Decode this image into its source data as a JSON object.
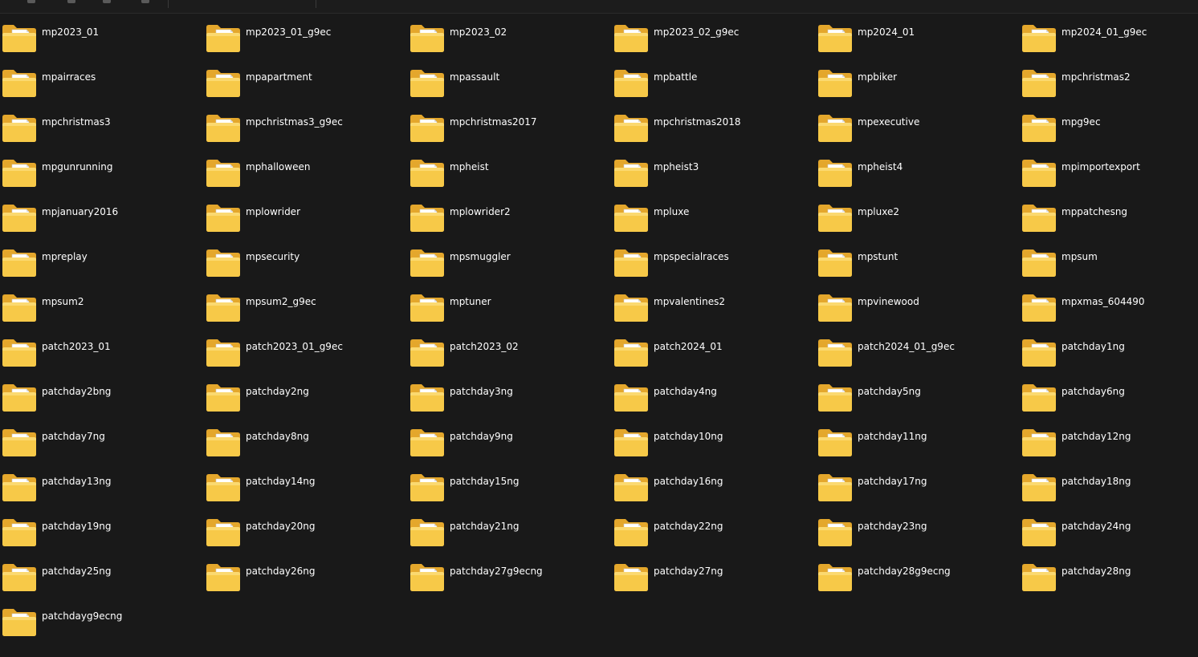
{
  "toolbar": {
    "icons": [
      "view-icon",
      "share-icon",
      "copy-icon",
      "delete-icon"
    ]
  },
  "colors": {
    "background": "#191919",
    "text": "#ffffff",
    "folder_front": "#f7c948",
    "folder_back": "#e4a72c"
  },
  "folders": [
    "mp2023_01",
    "mp2023_01_g9ec",
    "mp2023_02",
    "mp2023_02_g9ec",
    "mp2024_01",
    "mp2024_01_g9ec",
    "mpairraces",
    "mpapartment",
    "mpassault",
    "mpbattle",
    "mpbiker",
    "mpchristmas2",
    "mpchristmas3",
    "mpchristmas3_g9ec",
    "mpchristmas2017",
    "mpchristmas2018",
    "mpexecutive",
    "mpg9ec",
    "mpgunrunning",
    "mphalloween",
    "mpheist",
    "mpheist3",
    "mpheist4",
    "mpimportexport",
    "mpjanuary2016",
    "mplowrider",
    "mplowrider2",
    "mpluxe",
    "mpluxe2",
    "mppatchesng",
    "mpreplay",
    "mpsecurity",
    "mpsmuggler",
    "mpspecialraces",
    "mpstunt",
    "mpsum",
    "mpsum2",
    "mpsum2_g9ec",
    "mptuner",
    "mpvalentines2",
    "mpvinewood",
    "mpxmas_604490",
    "patch2023_01",
    "patch2023_01_g9ec",
    "patch2023_02",
    "patch2024_01",
    "patch2024_01_g9ec",
    "patchday1ng",
    "patchday2bng",
    "patchday2ng",
    "patchday3ng",
    "patchday4ng",
    "patchday5ng",
    "patchday6ng",
    "patchday7ng",
    "patchday8ng",
    "patchday9ng",
    "patchday10ng",
    "patchday11ng",
    "patchday12ng",
    "patchday13ng",
    "patchday14ng",
    "patchday15ng",
    "patchday16ng",
    "patchday17ng",
    "patchday18ng",
    "patchday19ng",
    "patchday20ng",
    "patchday21ng",
    "patchday22ng",
    "patchday23ng",
    "patchday24ng",
    "patchday25ng",
    "patchday26ng",
    "patchday27g9ecng",
    "patchday27ng",
    "patchday28g9ecng",
    "patchday28ng",
    "patchdayg9ecng"
  ]
}
